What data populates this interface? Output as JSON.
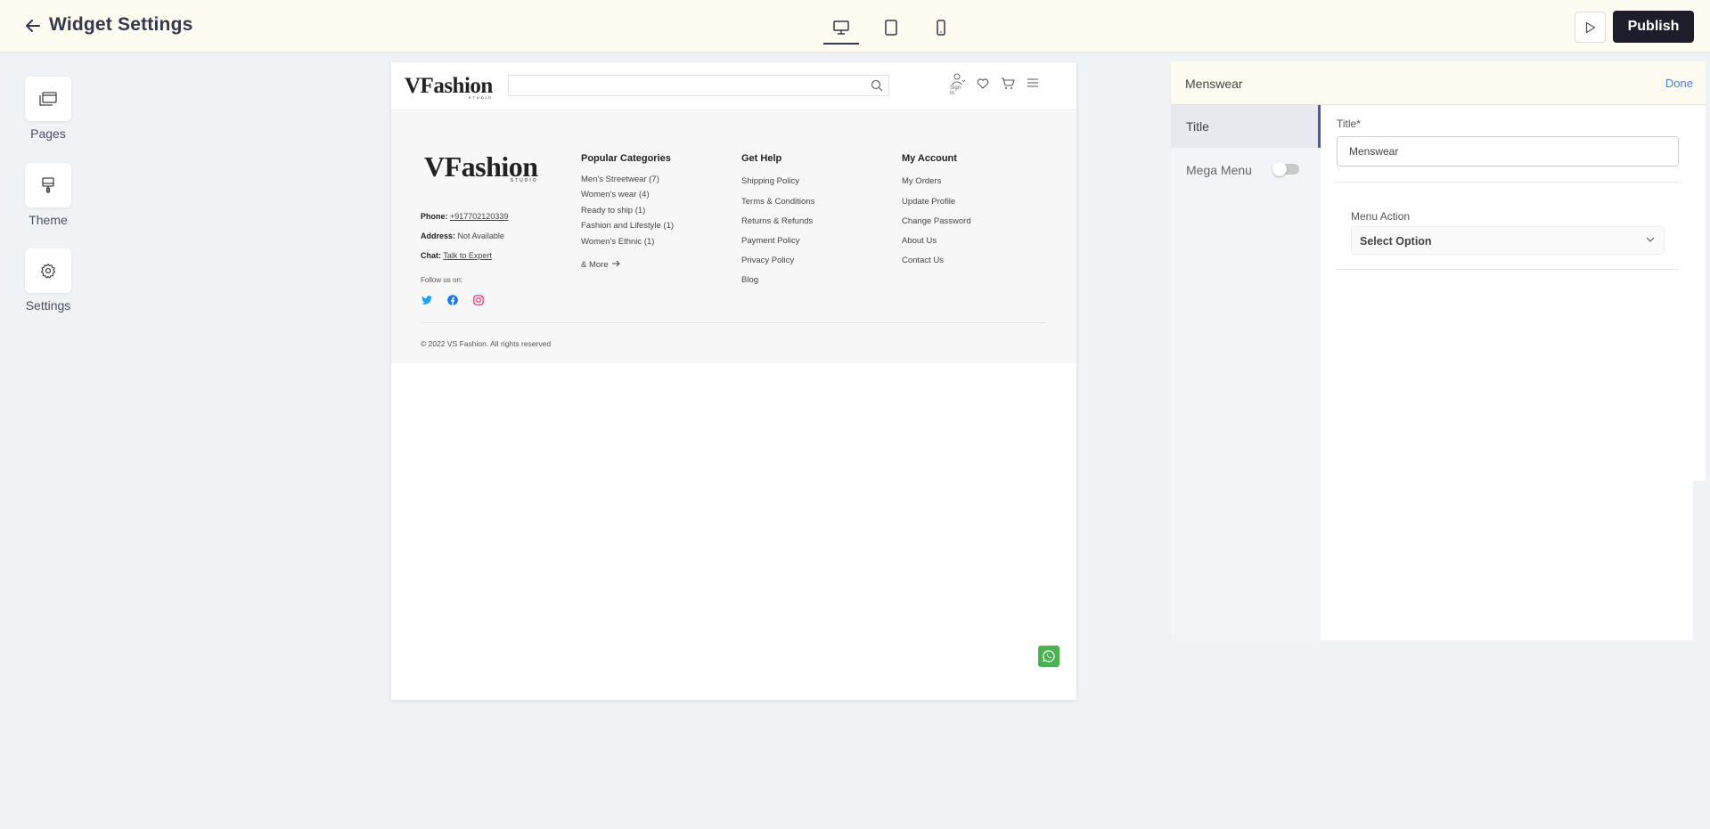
{
  "topbar": {
    "title": "Widget Settings",
    "devices": [
      "desktop-icon",
      "tablet-icon",
      "mobile-icon"
    ],
    "active_device": "desktop",
    "publish_label": "Publish"
  },
  "sidebar": {
    "items": [
      {
        "label": "Pages",
        "icon": "pages-icon"
      },
      {
        "label": "Theme",
        "icon": "theme-icon"
      },
      {
        "label": "Settings",
        "icon": "gear-icon"
      }
    ]
  },
  "site": {
    "logo": "VFashion",
    "logo_sub": "STUDIO",
    "signin_label": "Sign In",
    "contact": {
      "phone_label": "Phone:",
      "phone_value": "+917702120339",
      "address_label": "Address:",
      "address_value": "Not Available",
      "chat_label": "Chat:",
      "chat_value": "Talk to Expert"
    },
    "follow_label": "Follow us on:",
    "columns": [
      {
        "title": "Popular Categories",
        "links": [
          "Men's Streetwear (7)",
          "Women's wear (4)",
          "Ready to ship (1)",
          "Fashion and Lifestyle (1)",
          "Women's Ethnic (1)"
        ],
        "more": "& More"
      },
      {
        "title": "Get Help",
        "links": [
          "Shipping Policy",
          "Terms & Conditions",
          "Returns & Refunds",
          "Payment Policy",
          "Privacy Policy",
          "Blog"
        ]
      },
      {
        "title": "My Account",
        "links": [
          "My Orders",
          "Update Profile",
          "Change Password",
          "About Us",
          "Contact Us"
        ]
      }
    ],
    "copyright": "© 2022 VS Fashion. All rights reserved",
    "colors": {
      "twitter": "#1da1f2",
      "facebook": "#1877f2",
      "instagram": "#e1306c",
      "whatsapp": "#4caf50"
    }
  },
  "panel": {
    "header_title": "Menswear",
    "done_label": "Done",
    "nav_title": "Title",
    "nav_mega": "Mega Menu",
    "title_label": "Title*",
    "title_value": "Menswear",
    "menu_action_label": "Menu Action",
    "menu_action_value": "Select Option"
  }
}
